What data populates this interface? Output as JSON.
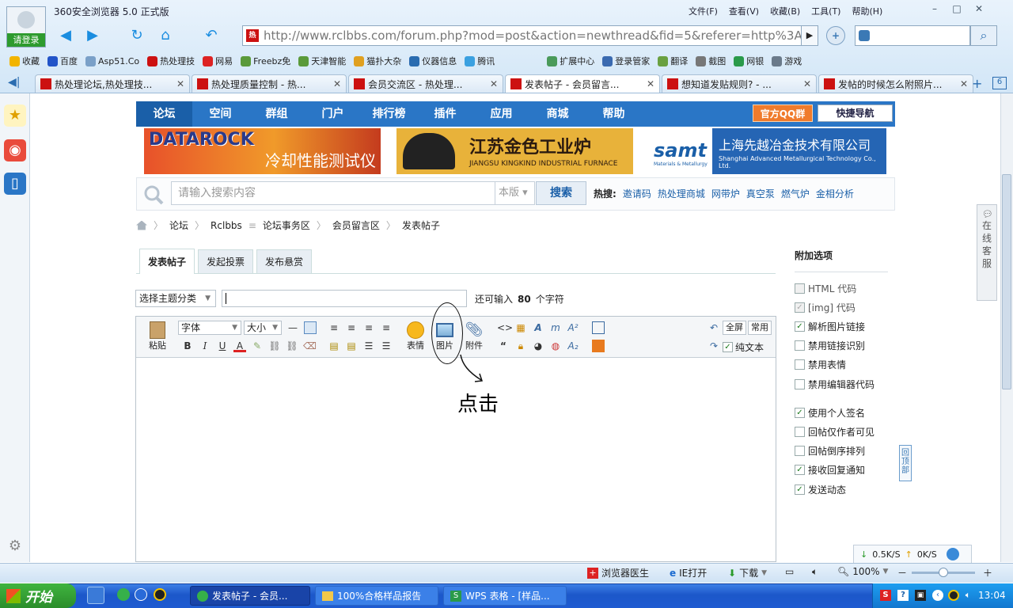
{
  "browser": {
    "app_name": "360安全浏览器 5.0 正式版",
    "login_label": "请登录",
    "menu": [
      "文件(F)",
      "查看(V)",
      "收藏(B)",
      "工具(T)",
      "帮助(H)"
    ],
    "url": "http://www.rclbbs.com/forum.php?mod=post&action=newthread&fid=5&referer=http%3A//www.rclb",
    "bookmarks": [
      "收藏",
      "百度",
      "Asp51.Co",
      "热处理技",
      "网易",
      "Freebz免",
      "天津智能",
      "猫扑大杂",
      "仪器信息",
      "腾讯",
      "扩展中心",
      "登录管家",
      "翻译",
      "截图",
      "网银",
      "游戏"
    ],
    "tabs": [
      {
        "title": "热处理论坛,热处理技..."
      },
      {
        "title": "热处理质量控制 - 热..."
      },
      {
        "title": "会员交流区 - 热处理..."
      },
      {
        "title": "发表帖子 - 会员留言..."
      },
      {
        "title": "想知道发贴规则? - ..."
      },
      {
        "title": "发帖的时候怎么附照片..."
      }
    ],
    "tab_count": "6"
  },
  "forum": {
    "nav": [
      "论坛",
      "空间",
      "群组",
      "门户",
      "排行榜",
      "插件",
      "应用",
      "商城",
      "帮助"
    ],
    "qq_group": "官方QQ群",
    "quick_nav": "快捷导航",
    "ads": {
      "ad1_brand": "DATAROCK",
      "ad1_text": "冷却性能测试仪",
      "ad2_cn": "江苏金色工业炉",
      "ad2_en": "JIANGSU KINGKIND INDUSTRIAL FURNACE",
      "ad3_logo": "samt",
      "ad3_sub": "Materials & Metallurgy",
      "ad3_cn": "上海先越冶金技术有限公司",
      "ad3_en": "Shanghai Advanced Metallurgical Technology Co., Ltd."
    },
    "search": {
      "placeholder": "请输入搜索内容",
      "scope": "本版",
      "button": "搜索",
      "hot_label": "热搜:",
      "hot": [
        "邀请码",
        "热处理商城",
        "网带炉",
        "真空泵",
        "燃气炉",
        "金相分析"
      ]
    },
    "breadcrumb": [
      "论坛",
      "Rclbbs",
      "论坛事务区",
      "会员留言区",
      "发表帖子"
    ],
    "post_tabs": [
      "发表帖子",
      "发起投票",
      "发布悬赏"
    ],
    "category_placeholder": "选择主题分类",
    "remain_prefix": "还可输入",
    "remain_count": "80",
    "remain_suffix": "个字符",
    "editor": {
      "paste": "粘贴",
      "font": "字体",
      "size": "大小",
      "emoji": "表情",
      "image": "图片",
      "attachment": "附件",
      "fullscreen": "全屏",
      "common": "常用",
      "plain_text": "纯文本"
    },
    "annotation": "点击",
    "options_title": "附加选项",
    "options": [
      {
        "label": "HTML 代码",
        "checked": false,
        "disabled": true
      },
      {
        "label": "[img] 代码",
        "checked": true,
        "disabled": true
      },
      {
        "label": "解析图片链接",
        "checked": true,
        "disabled": false
      },
      {
        "label": "禁用链接识别",
        "checked": false,
        "disabled": false
      },
      {
        "label": "禁用表情",
        "checked": false,
        "disabled": false
      },
      {
        "label": "禁用编辑器代码",
        "checked": false,
        "disabled": false
      },
      {
        "label": "使用个人签名",
        "checked": true,
        "disabled": false
      },
      {
        "label": "回帖仅作者可见",
        "checked": false,
        "disabled": false
      },
      {
        "label": "回帖倒序排列",
        "checked": false,
        "disabled": false
      },
      {
        "label": "接收回复通知",
        "checked": true,
        "disabled": false
      },
      {
        "label": "发送动态",
        "checked": true,
        "disabled": false
      }
    ],
    "online_service": "在线客服",
    "back_top": "回顶部"
  },
  "statusbar": {
    "speed_down": "0.5K/S",
    "speed_up": "0K/S",
    "doctor": "浏览器医生",
    "ie_open": "IE打开",
    "download": "下载",
    "zoom": "100%"
  },
  "taskbar": {
    "start": "开始",
    "tasks": [
      "发表帖子 - 会员...",
      "100%合格样品报告",
      "WPS 表格 - [样品..."
    ],
    "clock": "13:04"
  }
}
